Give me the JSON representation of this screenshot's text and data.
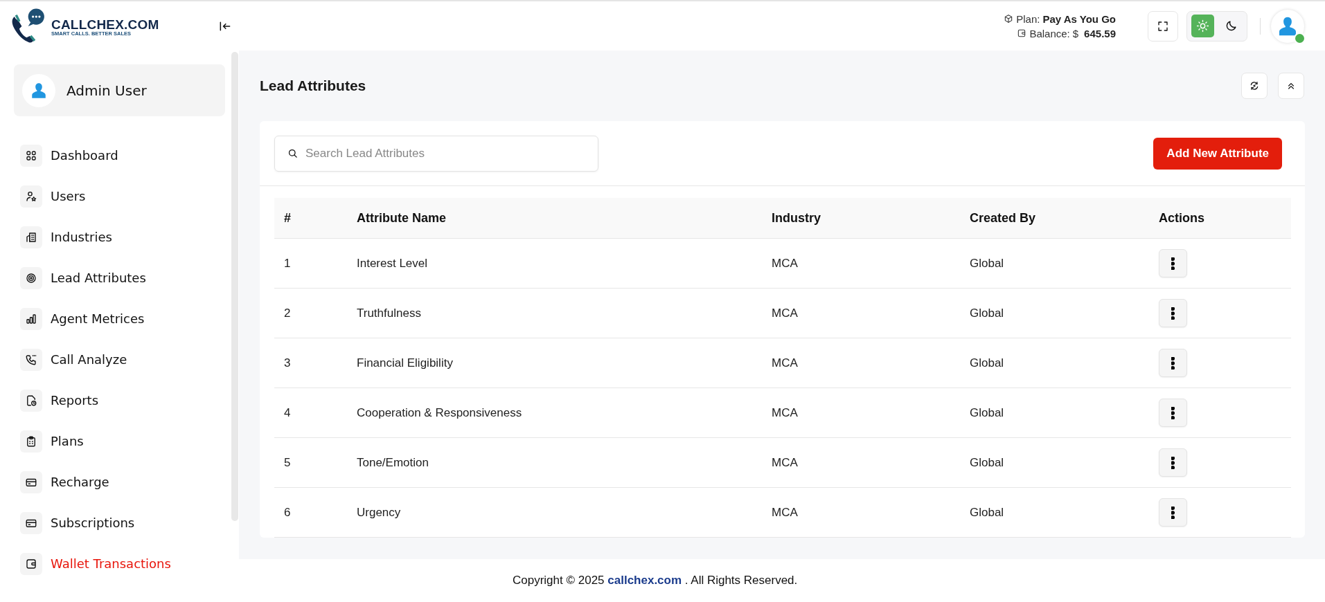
{
  "logo": {
    "name": "CALLCHEX.COM",
    "tagline": "SMART CALLS. BETTER SALES"
  },
  "header": {
    "plan": {
      "label": "Plan:",
      "value": "Pay As You Go"
    },
    "balance": {
      "label": "Balance:",
      "currency": "$",
      "value": "645.59"
    },
    "theme_toggle": [
      {
        "kind": "light",
        "selected": true
      },
      {
        "kind": "dark",
        "selected": false
      }
    ],
    "avatar": {
      "online": true
    }
  },
  "sidebar": {
    "user": {
      "name": "Admin User"
    },
    "items": [
      {
        "label": "Dashboard",
        "selected": false
      },
      {
        "label": "Users",
        "selected": false
      },
      {
        "label": "Industries",
        "selected": false
      },
      {
        "label": "Lead Attributes",
        "selected": false
      },
      {
        "label": "Agent Metrices",
        "selected": false
      },
      {
        "label": "Call Analyze",
        "selected": false
      },
      {
        "label": "Reports",
        "selected": false
      },
      {
        "label": "Plans",
        "selected": false
      },
      {
        "label": "Recharge",
        "selected": false
      },
      {
        "label": "Subscriptions",
        "selected": false
      },
      {
        "label": "Wallet Transactions",
        "selected": true
      }
    ]
  },
  "page": {
    "title": "Lead Attributes"
  },
  "search": {
    "placeholder": "Search Lead Attributes"
  },
  "add_button": "Add New Attribute",
  "table": {
    "columns": [
      "#",
      "Attribute Name",
      "Industry",
      "Created By",
      "Actions"
    ],
    "rows": [
      [
        "1",
        "Interest Level",
        "MCA",
        "Global"
      ],
      [
        "2",
        "Truthfulness",
        "MCA",
        "Global"
      ],
      [
        "3",
        "Financial Eligibility",
        "MCA",
        "Global"
      ],
      [
        "4",
        "Cooperation & Responsiveness",
        "MCA",
        "Global"
      ],
      [
        "5",
        "Tone/Emotion",
        "MCA",
        "Global"
      ],
      [
        "6",
        "Urgency",
        "MCA",
        "Global"
      ]
    ]
  },
  "footer": {
    "before": "Copyright © 2025 ",
    "link": "callchex.com",
    "after": " . All Rights Reserved."
  }
}
